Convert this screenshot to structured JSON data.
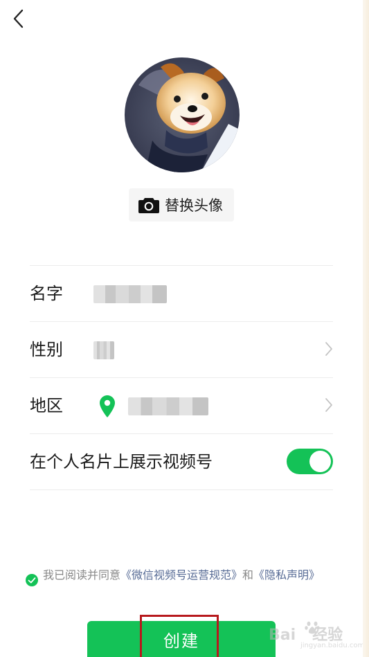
{
  "change_avatar": {
    "label": "替换头像"
  },
  "form": {
    "name": {
      "label": "名字"
    },
    "gender": {
      "label": "性别"
    },
    "region": {
      "label": "地区"
    },
    "show_channel": {
      "label": "在个人名片上展示视频号",
      "enabled": true
    }
  },
  "agreement": {
    "prefix": "我已阅读并同意",
    "rules_link": "《微信视频号运营规范》",
    "conjunction": "和",
    "privacy_link": "《隐私声明》",
    "checked": true
  },
  "create_button": {
    "label": "创建"
  },
  "watermark": {
    "brand_a": "Bai",
    "brand_b": "经验",
    "url": "jingyan.baidu.com"
  },
  "colors": {
    "accent": "#14c257",
    "link": "#576b95",
    "highlight": "#b7191d"
  },
  "icons": {
    "back": "chevron-left-icon",
    "camera": "camera-icon",
    "chevron": "chevron-right-icon",
    "location": "location-pin-icon",
    "check": "check-circle-icon"
  }
}
